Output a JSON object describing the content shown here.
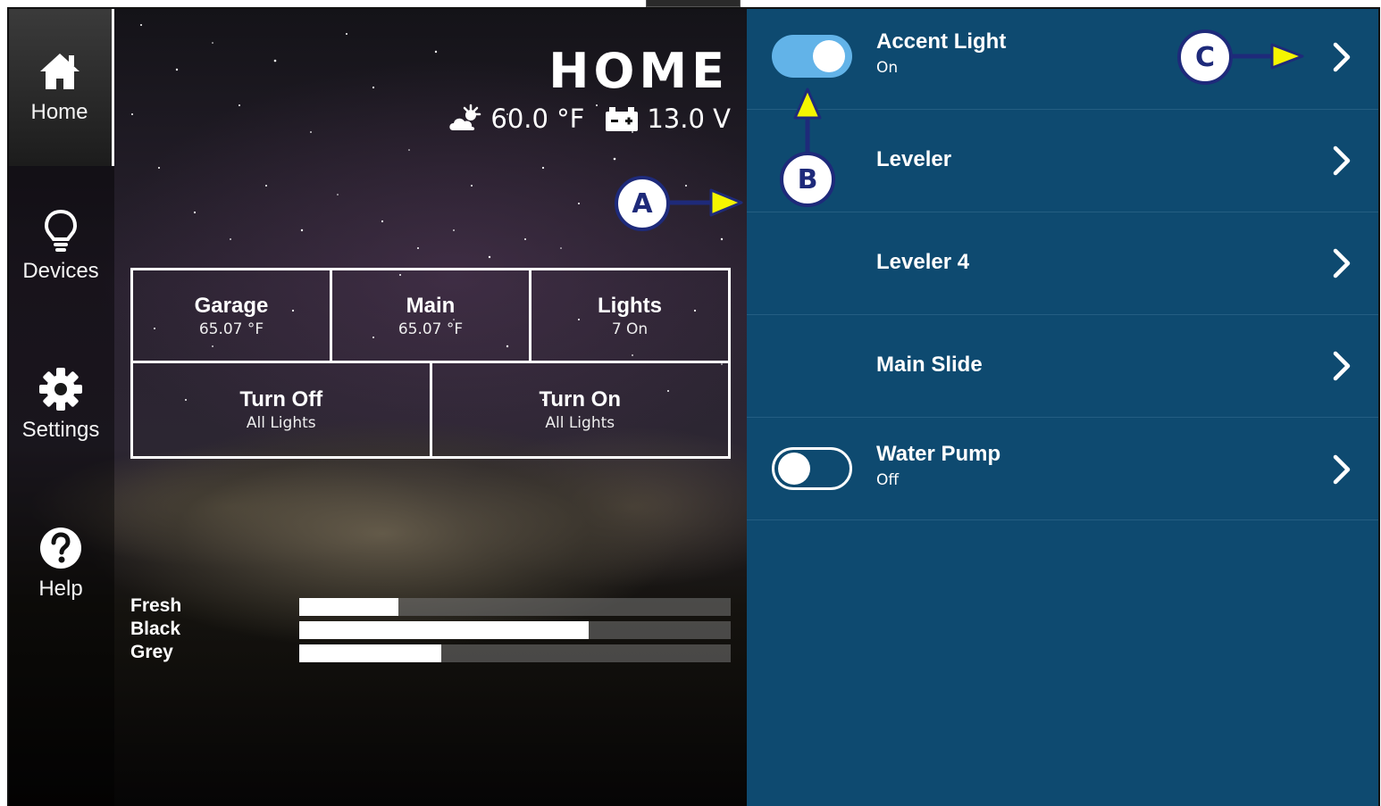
{
  "sidebar": {
    "items": [
      {
        "label": "Home",
        "icon": "home-icon"
      },
      {
        "label": "Devices",
        "icon": "lightbulb-icon"
      },
      {
        "label": "Settings",
        "icon": "gear-icon"
      },
      {
        "label": "Help",
        "icon": "help-icon"
      }
    ]
  },
  "header": {
    "title": "HOME",
    "temperature": "60.0 °F",
    "voltage": "13.0 V"
  },
  "tiles": {
    "garage": {
      "title": "Garage",
      "value": "65.07 °F"
    },
    "main": {
      "title": "Main",
      "value": "65.07 °F"
    },
    "lights": {
      "title": "Lights",
      "value": "7 On"
    },
    "turn_off": {
      "title": "Turn Off",
      "value": "All Lights"
    },
    "turn_on": {
      "title": "Turn On",
      "value": "All Lights"
    }
  },
  "tanks": [
    {
      "label": "Fresh",
      "level": 0.23
    },
    {
      "label": "Black",
      "level": 0.67
    },
    {
      "label": "Grey",
      "level": 0.33
    }
  ],
  "devices": [
    {
      "name": "Accent Light",
      "state": "On",
      "toggle": "on"
    },
    {
      "name": "Leveler"
    },
    {
      "name": "Leveler 4"
    },
    {
      "name": "Main Slide"
    },
    {
      "name": "Water Pump",
      "state": "Off",
      "toggle": "off"
    }
  ],
  "callouts": {
    "a": "A",
    "b": "B",
    "c": "C"
  },
  "colors": {
    "panel_blue": "#0e4a70",
    "toggle_on": "#62b3e8",
    "callout_border": "#1e2a7a",
    "arrow_yellow": "#f5f500"
  }
}
